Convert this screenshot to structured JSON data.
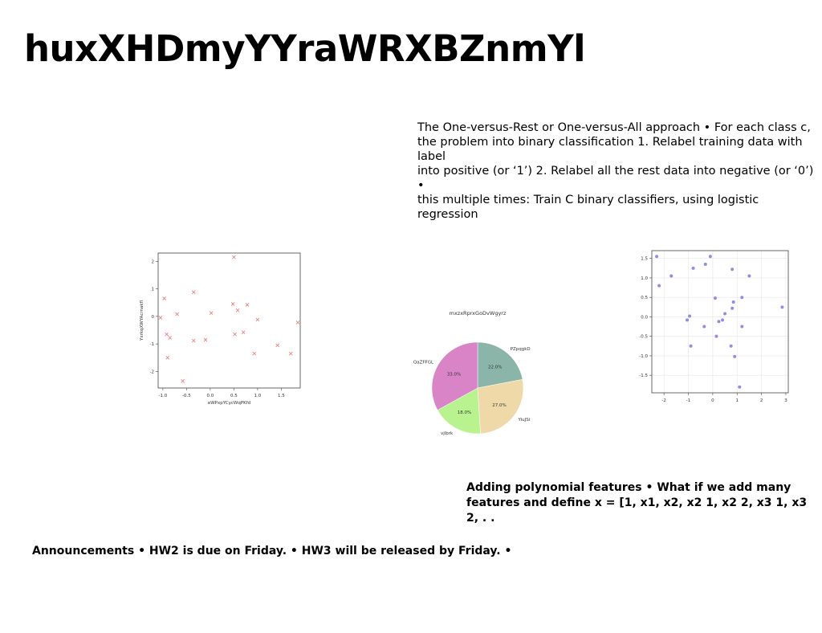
{
  "slide": {
    "title": "huxXHDmyYYraWRXBZnmYl",
    "paragraph": "The One-versus-Rest or One-versus-All approach • For each class c,\nthe problem into binary classification 1. Relabel training data with label\ninto positive (or ‘1’) 2. Relabel all the rest data into negative (or ‘0’) •\nthis multiple times: Train C binary classifiers, using logistic regression",
    "polynomial_text": "Adding polynomial features • What if we add many\nfeatures and define x = [1, x1, x2, x2 1, x2 2, x3 1, x3 2, . .",
    "announcements": "Announcements • HW2 is due on Friday. • HW3 will be released by Friday. •"
  },
  "chart_data": [
    {
      "type": "scatter",
      "marker": "x",
      "color": "#f08080",
      "xlabel": "eWPxpYCycWqPKfd",
      "ylabel": "YxrkqXWYAcrnakfl",
      "xlim": [
        -1.1,
        1.9
      ],
      "ylim": [
        -2.6,
        2.3
      ],
      "xticks": [
        "-1.0",
        "-0.5",
        "0.0",
        "0.5",
        "1.0",
        "1.5"
      ],
      "xtick_values": [
        -1.0,
        -0.5,
        0.0,
        0.5,
        1.0,
        1.5
      ],
      "yticks": [
        "2",
        "1",
        "0",
        "-1",
        "-2"
      ],
      "ytick_values": [
        2,
        1,
        0,
        -1,
        -2
      ],
      "points": [
        [
          -0.97,
          0.65
        ],
        [
          -1.05,
          -0.05
        ],
        [
          -0.92,
          -0.65
        ],
        [
          -0.85,
          -0.78
        ],
        [
          -0.9,
          -1.5
        ],
        [
          -0.7,
          0.08
        ],
        [
          -0.58,
          -2.35
        ],
        [
          -0.35,
          0.88
        ],
        [
          -0.35,
          -0.88
        ],
        [
          -0.1,
          -0.85
        ],
        [
          0.02,
          0.12
        ],
        [
          0.48,
          0.45
        ],
        [
          0.5,
          2.15
        ],
        [
          0.52,
          -0.65
        ],
        [
          0.58,
          0.22
        ],
        [
          0.7,
          -0.58
        ],
        [
          0.78,
          0.42
        ],
        [
          0.93,
          -1.35
        ],
        [
          1.0,
          -0.12
        ],
        [
          1.42,
          -1.05
        ],
        [
          1.7,
          -1.35
        ],
        [
          1.85,
          -0.22
        ]
      ]
    },
    {
      "type": "pie",
      "title": "mxzxRprxGoDvWgyrz",
      "labels": [
        "PZpqgkD",
        "YiuJSi",
        "vjlbrk",
        "QaZFFGL"
      ],
      "values": [
        22.0,
        27.0,
        18.0,
        33.0
      ],
      "percent_labels": [
        "22.0%",
        "27.0%",
        "18.0%",
        "33.0%"
      ],
      "colors": [
        "#8bb5a8",
        "#efd9a9",
        "#b8f38f",
        "#d884c6"
      ]
    },
    {
      "type": "scatter",
      "marker": "o",
      "color": "#8f8fe0",
      "xlim": [
        -2.5,
        3.1
      ],
      "ylim": [
        -1.95,
        1.7
      ],
      "xticks": [
        "-2",
        "-1",
        "0",
        "1",
        "2",
        "3"
      ],
      "xtick_values": [
        -2,
        -1,
        0,
        1,
        2,
        3
      ],
      "yticks": [
        "1.5",
        "1.0",
        "0.5",
        "0.0",
        "-0.5",
        "-1.0",
        "-1.5"
      ],
      "ytick_values": [
        1.5,
        1.0,
        0.5,
        0.0,
        -0.5,
        -1.0,
        -1.5
      ],
      "points": [
        [
          -2.3,
          1.55
        ],
        [
          -2.2,
          0.8
        ],
        [
          -1.7,
          1.05
        ],
        [
          -0.8,
          1.25
        ],
        [
          -0.3,
          1.35
        ],
        [
          -0.1,
          1.55
        ],
        [
          0.8,
          1.22
        ],
        [
          1.5,
          1.05
        ],
        [
          0.1,
          0.48
        ],
        [
          1.2,
          0.5
        ],
        [
          0.85,
          0.38
        ],
        [
          0.8,
          0.22
        ],
        [
          2.85,
          0.25
        ],
        [
          0.5,
          0.08
        ],
        [
          0.4,
          -0.08
        ],
        [
          0.25,
          -0.12
        ],
        [
          -1.05,
          -0.08
        ],
        [
          -0.95,
          0.02
        ],
        [
          -0.35,
          -0.25
        ],
        [
          1.2,
          -0.25
        ],
        [
          0.15,
          -0.5
        ],
        [
          -0.9,
          -0.75
        ],
        [
          0.75,
          -0.75
        ],
        [
          0.9,
          -1.02
        ],
        [
          1.1,
          -1.8
        ]
      ]
    }
  ]
}
